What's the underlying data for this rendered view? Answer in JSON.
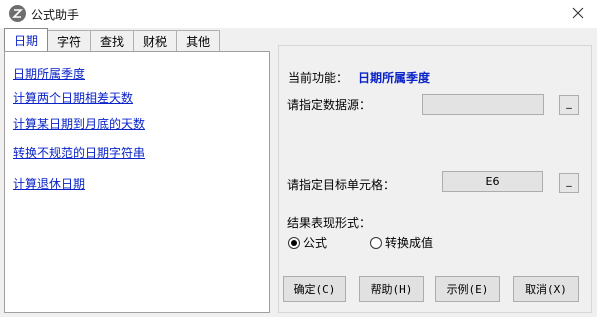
{
  "window": {
    "title": "公式助手",
    "app_icon": "app-logo-icon",
    "close_icon": "close-icon"
  },
  "tabs": [
    {
      "label": "日期",
      "active": true
    },
    {
      "label": "字符",
      "active": false
    },
    {
      "label": "查找",
      "active": false
    },
    {
      "label": "财税",
      "active": false
    },
    {
      "label": "其他",
      "active": false
    }
  ],
  "functions": [
    "日期所属季度",
    "计算两个日期相差天数",
    "计算某日期到月底的天数",
    "转换不规范的日期字符串",
    "计算退休日期"
  ],
  "detail": {
    "current_label": "当前功能：",
    "current_value": "日期所属季度",
    "source_label": "请指定数据源：",
    "source_value": "",
    "target_label": "请指定目标单元格：",
    "target_value": "E6",
    "picker_label": "_",
    "result_label": "结果表现形式：",
    "options": [
      {
        "label": "公式",
        "checked": true
      },
      {
        "label": "转换成值",
        "checked": false
      }
    ]
  },
  "buttons": {
    "ok": "确定(C)",
    "help": "帮助(H)",
    "example": "示例(E)",
    "cancel": "取消(X)"
  },
  "colors": {
    "link": "#0a23c8",
    "window_bg": "#f0f0f0",
    "panel_bg": "#ffffff"
  }
}
